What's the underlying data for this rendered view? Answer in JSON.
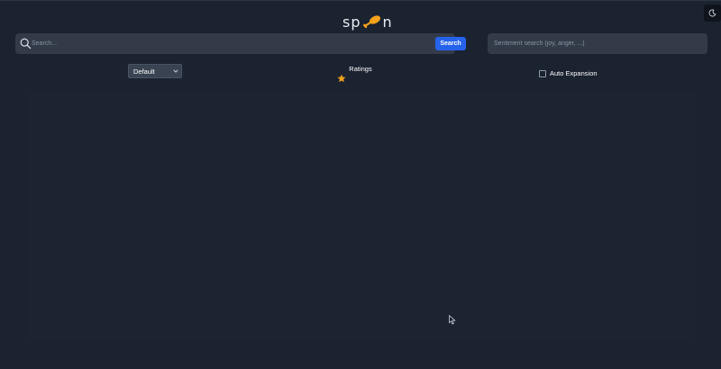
{
  "header": {
    "logo_left": "sp",
    "logo_right": "n",
    "logo_accent_color": "#f5a21b",
    "theme_toggle_icon": "moon-icon"
  },
  "search": {
    "placeholder": "Search...",
    "value": "",
    "button_label": "Search",
    "icon": "search-icon"
  },
  "sentiment": {
    "placeholder": "Sentiment search (joy, anger, ...)",
    "value": ""
  },
  "filters": {
    "sort_value": "Default",
    "ratings_label": "Ratings",
    "ratings_selected": 1,
    "ratings_max": 5,
    "auto_expansion_label": "Auto Expansion",
    "auto_expansion_checked": false
  },
  "colors": {
    "background": "#1b2230",
    "input_bg": "#333b49",
    "primary_button": "#2563eb",
    "star_filled": "#f5a21b"
  }
}
